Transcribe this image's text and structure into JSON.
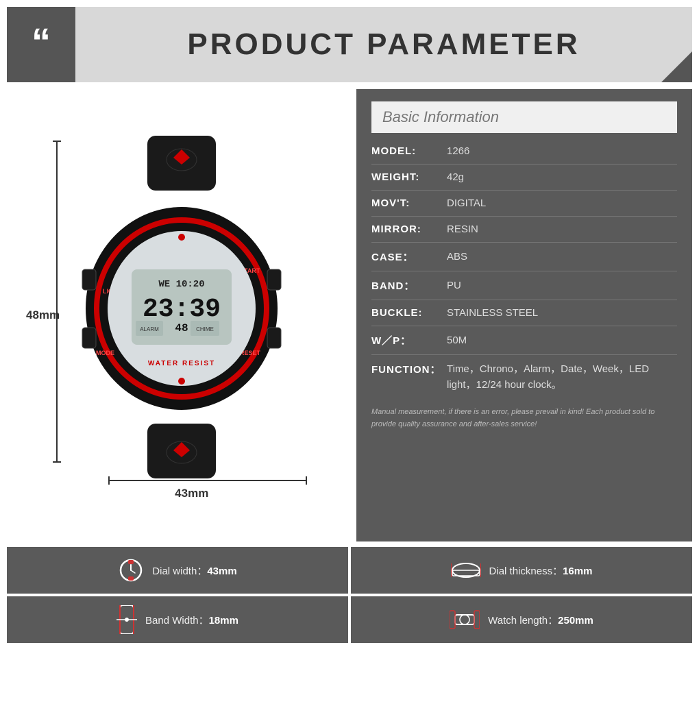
{
  "header": {
    "title": "PRODUCT PARAMETER",
    "quote_icon": "“"
  },
  "specs": {
    "section_title": "Basic Information",
    "rows": [
      {
        "key": "MODEL:",
        "value": "1266"
      },
      {
        "key": "WEIGHT:",
        "value": "42g"
      },
      {
        "key": "MOV’T:",
        "value": "DIGITAL"
      },
      {
        "key": "MIRROR:",
        "value": "RESIN"
      },
      {
        "key": "CASE：",
        "value": "ABS"
      },
      {
        "key": "BAND：",
        "value": "PU"
      },
      {
        "key": "BUCKLE:",
        "value": "STAINLESS STEEL"
      },
      {
        "key": "W ／ P：",
        "value": "50M"
      },
      {
        "key": "FUNCTION:",
        "value": "Time，Chrono，Alarm，Date，Week，LED light，12/24 hour clock。"
      }
    ],
    "note": "Manual measurement, if there is an error, please prevail in kind!\nEach product sold to provide quality assurance and after-sales service!"
  },
  "watch": {
    "height_label": "48mm",
    "width_label": "43mm"
  },
  "bottom": {
    "row1": [
      {
        "label": "Dial width：",
        "value": "43mm",
        "icon": "⌚"
      },
      {
        "label": "Dial thickness：",
        "value": "16mm",
        "icon": "🔴"
      }
    ],
    "row2": [
      {
        "label": "Band Width：",
        "value": "18mm",
        "icon": "📳"
      },
      {
        "label": "Watch length：",
        "value": "250mm",
        "icon": "🔗"
      }
    ]
  }
}
